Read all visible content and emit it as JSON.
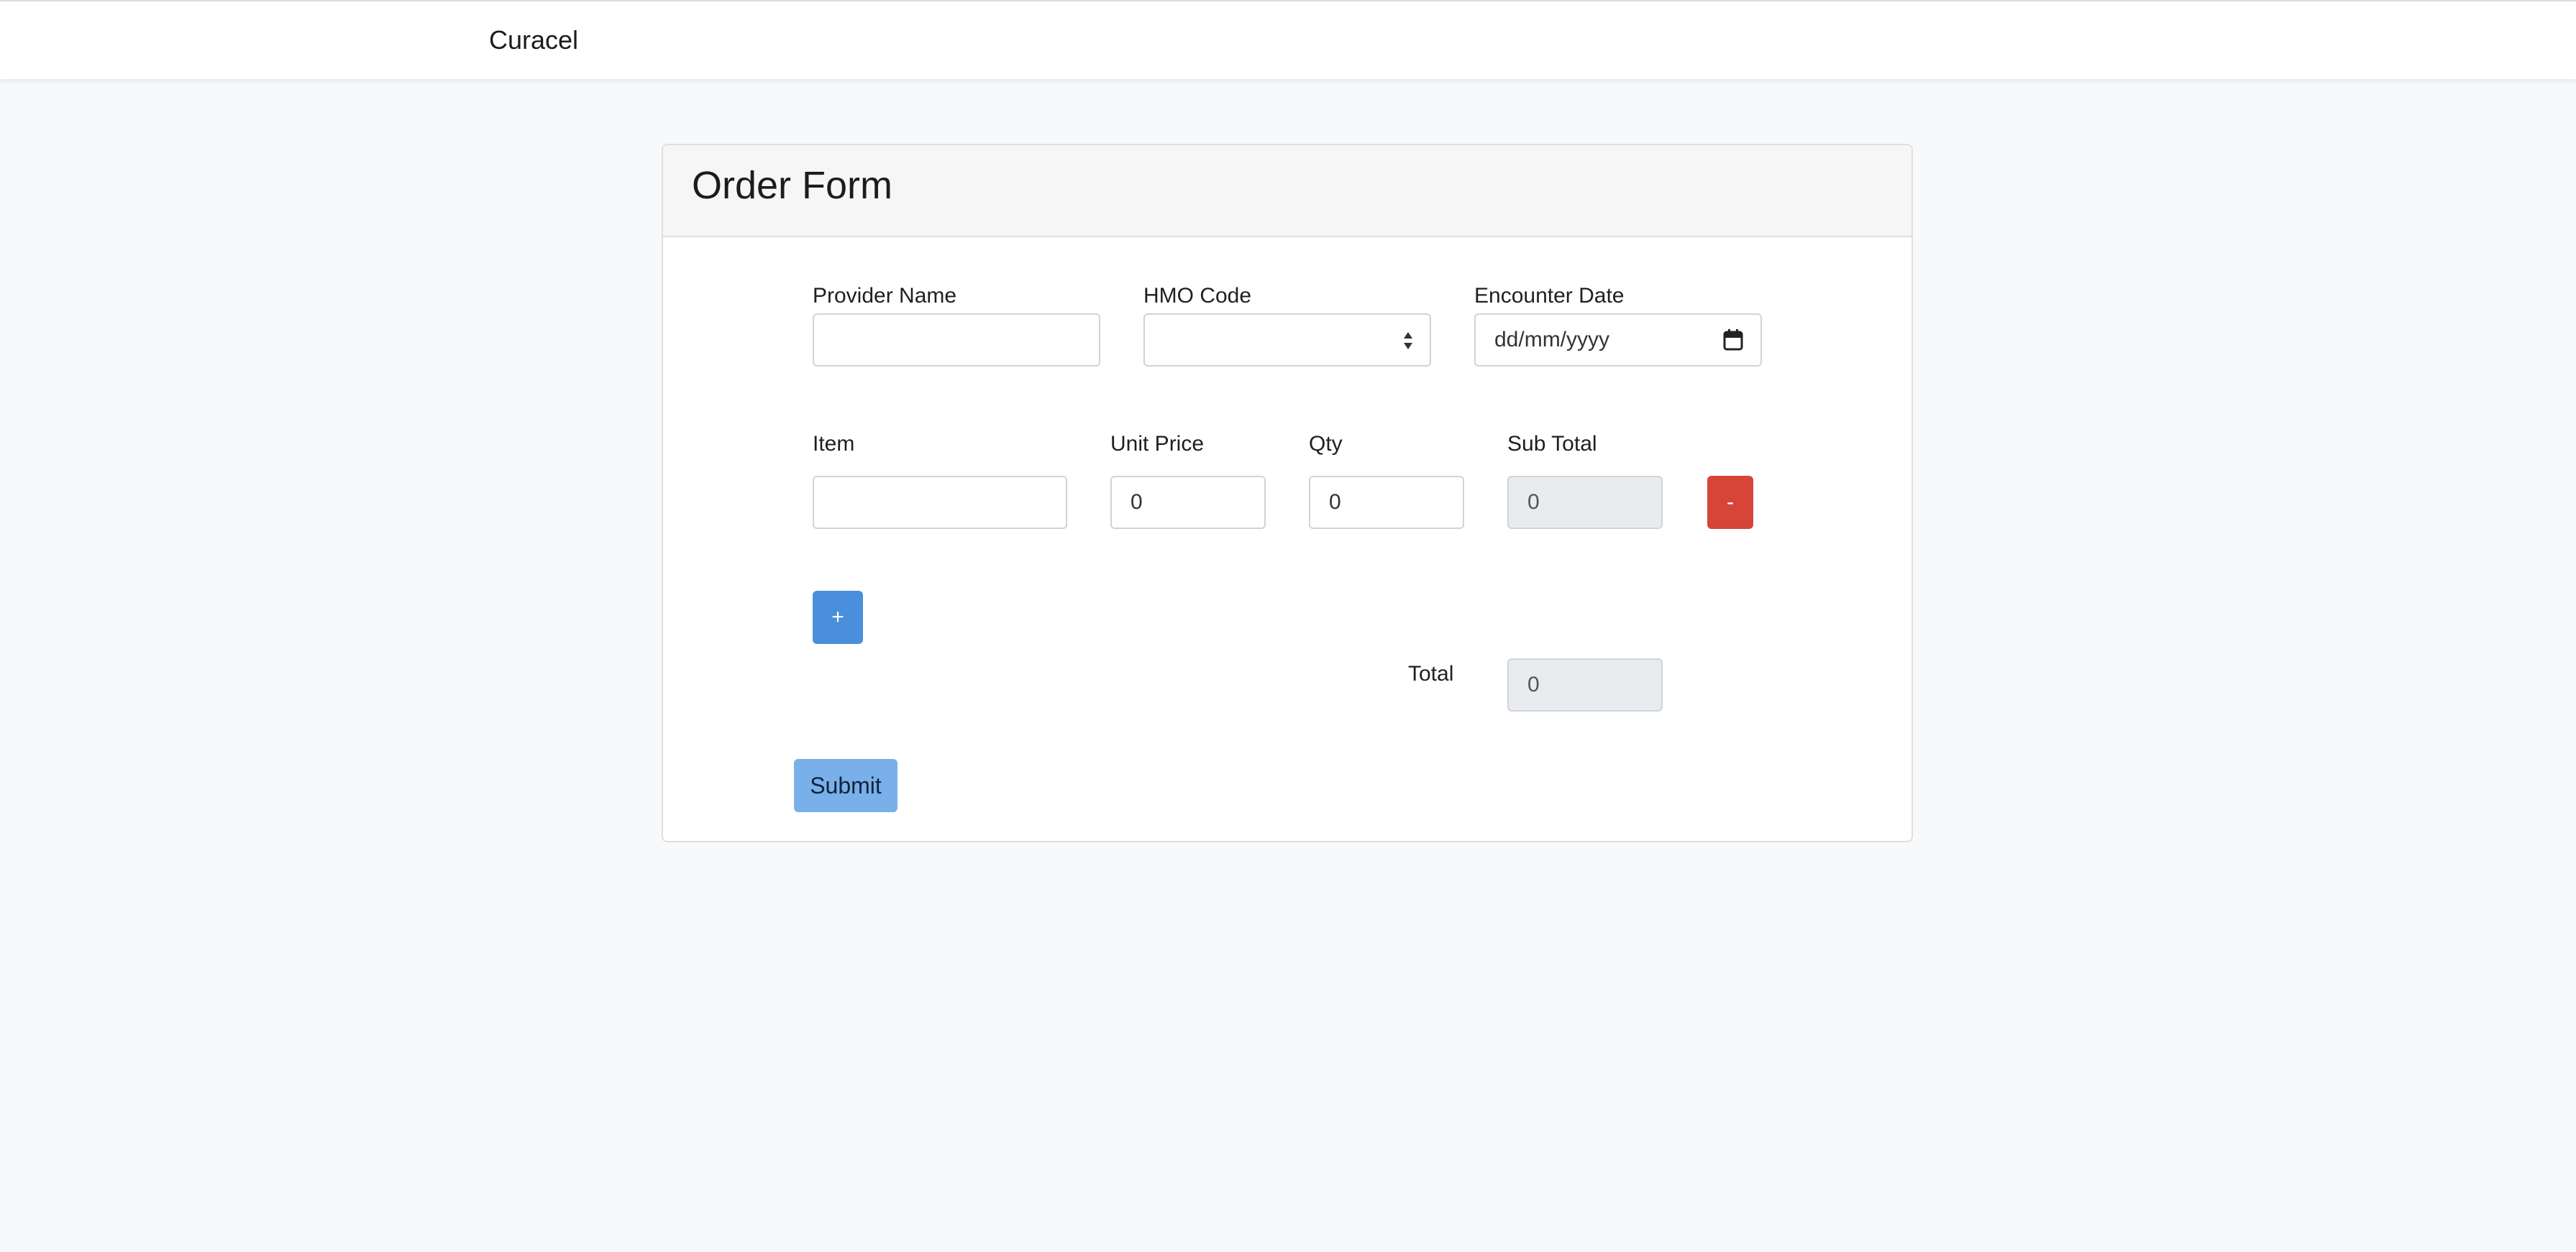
{
  "navbar": {
    "brand": "Curacel"
  },
  "form": {
    "title": "Order Form",
    "provider_name": {
      "label": "Provider Name",
      "value": ""
    },
    "hmo_code": {
      "label": "HMO Code",
      "selected": ""
    },
    "encounter_date": {
      "label": "Encounter Date",
      "placeholder": "dd/mm/yyyy"
    },
    "items_header": {
      "item": "Item",
      "unit_price": "Unit Price",
      "qty": "Qty",
      "sub_total": "Sub Total"
    },
    "rows": [
      {
        "item": "",
        "unit_price": "0",
        "qty": "0",
        "sub_total": "0",
        "remove_label": "-"
      }
    ],
    "add_label": "+",
    "total": {
      "label": "Total",
      "value": "0"
    },
    "submit_label": "Submit"
  },
  "colors": {
    "remove_button": "#d64538",
    "add_button": "#4a8fdb",
    "submit_button": "#79b0ea",
    "page_background": "#f8f9fb"
  },
  "icons": {
    "select": "sort-arrows-icon",
    "date": "calendar-icon"
  }
}
